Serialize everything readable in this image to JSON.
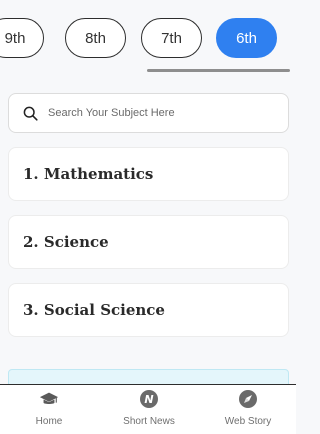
{
  "class_tabs": [
    {
      "label": "9th",
      "active": false
    },
    {
      "label": "8th",
      "active": false
    },
    {
      "label": "7th",
      "active": false
    },
    {
      "label": "6th",
      "active": true
    }
  ],
  "search": {
    "placeholder": "Search Your Subject Here",
    "value": ""
  },
  "subjects": [
    {
      "label": "1. Mathematics"
    },
    {
      "label": "2. Science"
    },
    {
      "label": "3. Social Science"
    }
  ],
  "bottom_nav": [
    {
      "label": "Home",
      "icon": "graduation-cap-icon"
    },
    {
      "label": "Short News",
      "icon": "news-icon"
    },
    {
      "label": "Web Story",
      "icon": "compass-icon"
    }
  ],
  "colors": {
    "accent": "#2f80f0",
    "teaser_bg": "#e4f6fb"
  }
}
